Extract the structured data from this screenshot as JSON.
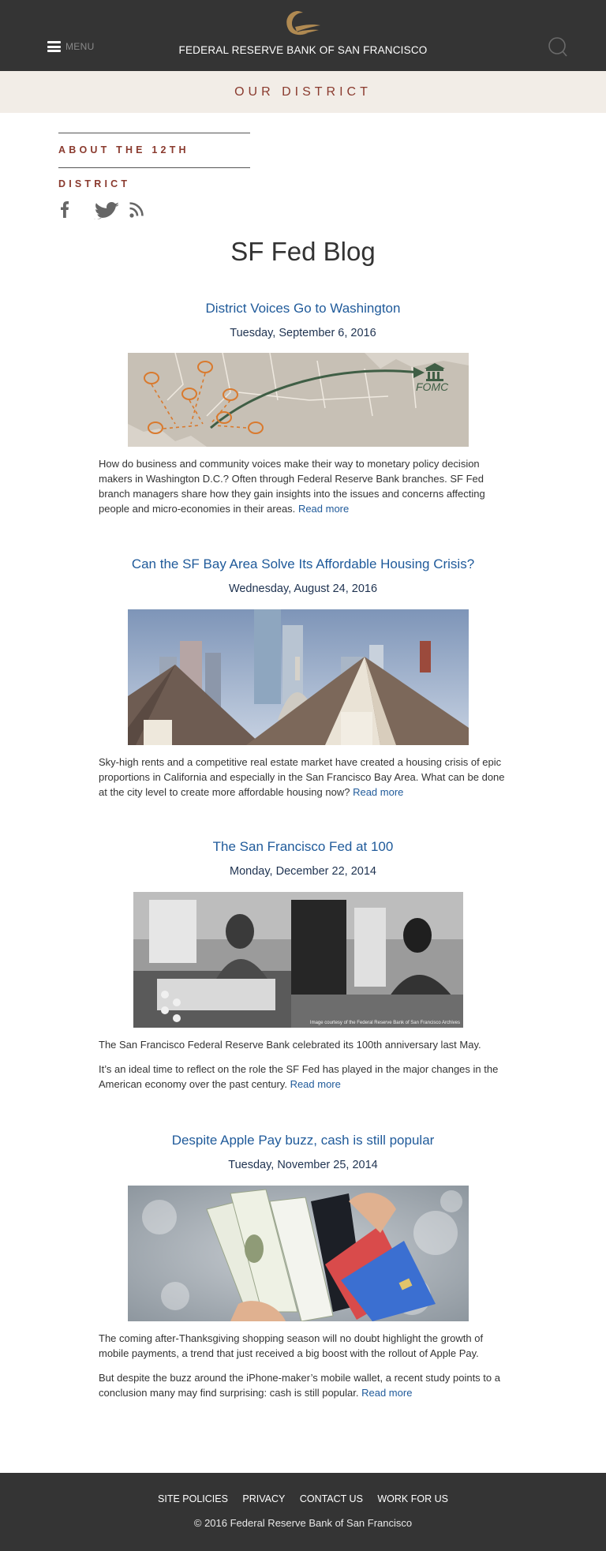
{
  "header": {
    "menu_label": "MENU",
    "site_title": "FEDERAL RESERVE BANK OF SAN FRANCISCO",
    "background": "#343434"
  },
  "section_band": {
    "label": "OUR DISTRICT",
    "text_color": "#8a3a2e",
    "background": "#f2ede7"
  },
  "about_link": {
    "label": "ABOUT THE 12TH DISTRICT"
  },
  "social": {
    "icons": [
      "facebook-icon",
      "twitter-icon",
      "rss-icon"
    ]
  },
  "blog": {
    "title": "SF Fed Blog",
    "posts": [
      {
        "title": "District Voices Go to Washington",
        "date": "Tuesday, September 6, 2016",
        "image_text": "FOMC",
        "paragraphs": [
          "How do business and community voices make their way to monetary policy decision makers in Washington D.C.? Often through Federal Reserve Bank branches. SF Fed branch managers share how they gain insights into the issues and concerns affecting people and micro-economies in their areas."
        ],
        "read_more": "Read more"
      },
      {
        "title": "Can the SF Bay Area Solve Its Affordable Housing Crisis?",
        "date": "Wednesday, August 24, 2016",
        "paragraphs": [
          "Sky-high rents and a competitive real estate market have created a housing crisis of epic proportions in California and especially in the San Francisco Bay Area. What can be done at the city level to create more affordable housing now?"
        ],
        "read_more": "Read more"
      },
      {
        "title": "The San Francisco Fed at 100",
        "date": "Monday, December 22, 2014",
        "image_caption": "Image courtesy of the Federal Reserve Bank of San Francisco Archives",
        "paragraphs": [
          "The San Francisco Federal Reserve Bank celebrated its 100th anniversary last May.",
          "It’s an ideal time to reflect on the role the SF Fed has played in the major changes in the American economy over the past century."
        ],
        "read_more": "Read more"
      },
      {
        "title": "Despite Apple Pay buzz, cash is still popular",
        "date": "Tuesday, November 25, 2014",
        "paragraphs": [
          "The coming after-Thanksgiving shopping season will no doubt highlight the growth of mobile payments, a trend that just received a big boost with the rollout of Apple Pay.",
          "But despite the buzz around the iPhone-maker’s mobile wallet, a recent study points to a conclusion many may find surprising: cash is still popular."
        ],
        "read_more": "Read more"
      }
    ]
  },
  "colors": {
    "link": "#1f5a9a",
    "date": "#1e3250",
    "accent": "#8a3a2e"
  },
  "footer": {
    "links": [
      "SITE POLICIES",
      "PRIVACY",
      "CONTACT US",
      "WORK FOR US"
    ],
    "copyright": "© 2016 Federal Reserve Bank of San Francisco"
  }
}
